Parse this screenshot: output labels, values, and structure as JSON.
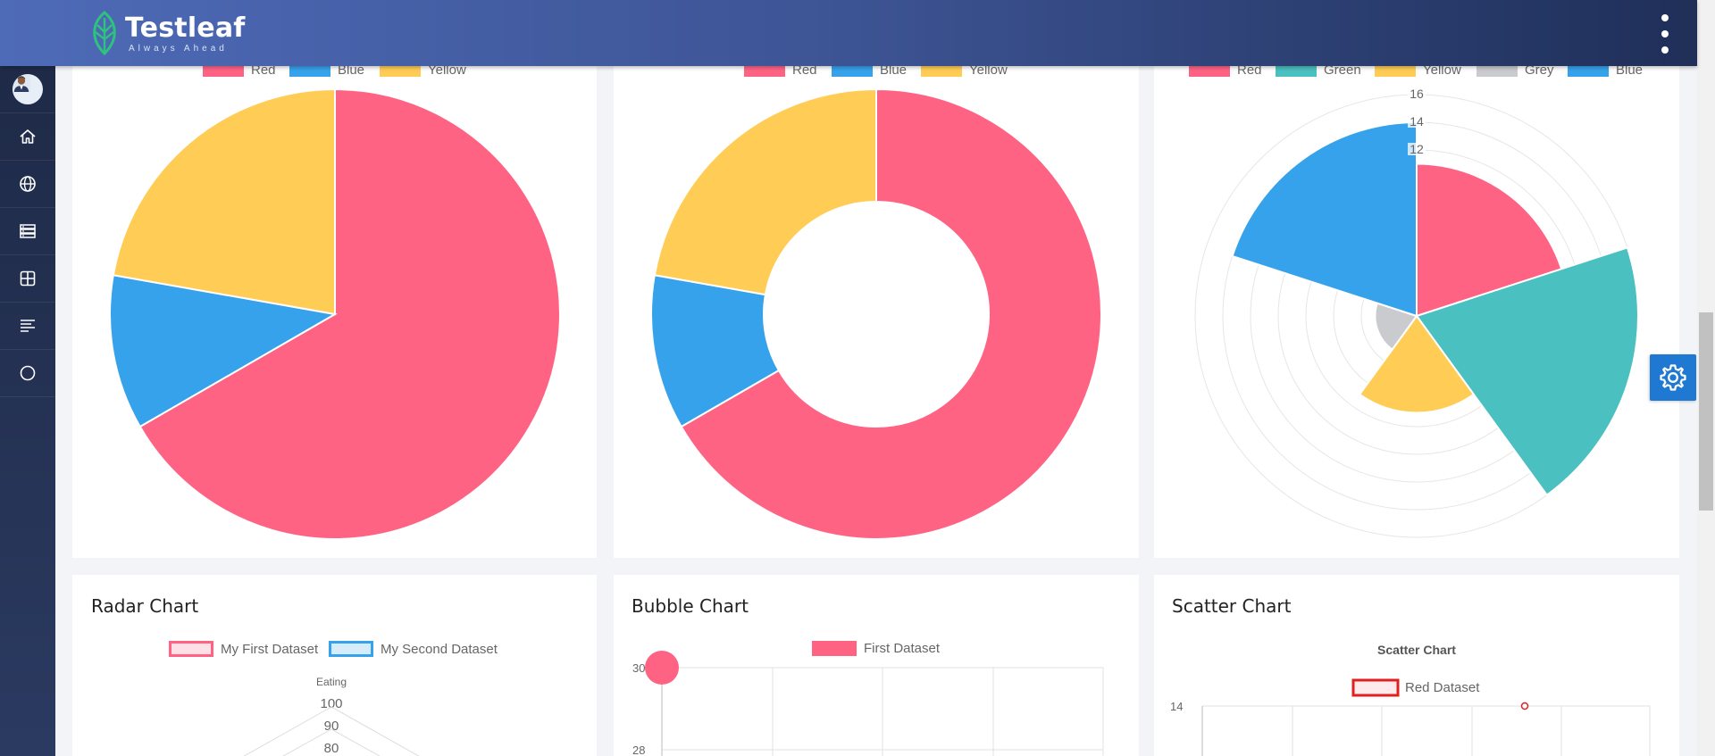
{
  "header": {
    "brand": "Testleaf",
    "tagline": "Always Ahead"
  },
  "sidebar": {
    "items": [
      {
        "icon": "avatar"
      },
      {
        "icon": "home-icon"
      },
      {
        "icon": "globe-icon"
      },
      {
        "icon": "server-icon"
      },
      {
        "icon": "grid-icon"
      },
      {
        "icon": "align-left-icon"
      },
      {
        "icon": "circle-icon"
      }
    ]
  },
  "colors": {
    "red": "#ff6384",
    "blue": "#36a2eb",
    "yellow": "#ffcd56",
    "green": "#4bc0c0",
    "grey": "#c9cbcf"
  },
  "pie": {
    "legend": [
      "Red",
      "Blue",
      "Yellow"
    ]
  },
  "doughnut": {
    "legend": [
      "Red",
      "Blue",
      "Yellow"
    ]
  },
  "polar": {
    "legend": [
      "Red",
      "Green",
      "Yellow",
      "Grey",
      "Blue"
    ],
    "ticks": [
      "16",
      "14",
      "12"
    ]
  },
  "radar": {
    "title": "Radar Chart",
    "legend": [
      "My First Dataset",
      "My Second Dataset"
    ],
    "axis_label": "Eating",
    "ticks": [
      "100",
      "90",
      "80"
    ]
  },
  "bubble": {
    "title": "Bubble Chart",
    "legend": [
      "First Dataset"
    ],
    "ticks": [
      "30",
      "28"
    ]
  },
  "scatter": {
    "title": "Scatter Chart",
    "chart_title": "Scatter Chart",
    "legend": [
      "Red Dataset"
    ],
    "ticks": [
      "14"
    ]
  },
  "chart_data": [
    {
      "type": "pie",
      "categories": [
        "Red",
        "Blue",
        "Yellow"
      ],
      "values": [
        300,
        50,
        100
      ]
    },
    {
      "type": "pie",
      "variant": "doughnut",
      "categories": [
        "Red",
        "Blue",
        "Yellow"
      ],
      "values": [
        300,
        50,
        100
      ]
    },
    {
      "type": "polarArea",
      "categories": [
        "Red",
        "Green",
        "Yellow",
        "Grey",
        "Blue"
      ],
      "values": [
        11,
        16,
        7,
        3,
        14
      ],
      "ylim": [
        0,
        16
      ]
    },
    {
      "type": "radar",
      "title": "Radar Chart",
      "categories": [
        "Eating"
      ],
      "series": [
        {
          "name": "My First Dataset"
        },
        {
          "name": "My Second Dataset"
        }
      ],
      "ylim": [
        0,
        100
      ]
    },
    {
      "type": "scatter",
      "variant": "bubble",
      "title": "Bubble Chart",
      "series": [
        {
          "name": "First Dataset"
        }
      ]
    },
    {
      "type": "scatter",
      "title": "Scatter Chart",
      "series": [
        {
          "name": "Red Dataset"
        }
      ]
    }
  ]
}
